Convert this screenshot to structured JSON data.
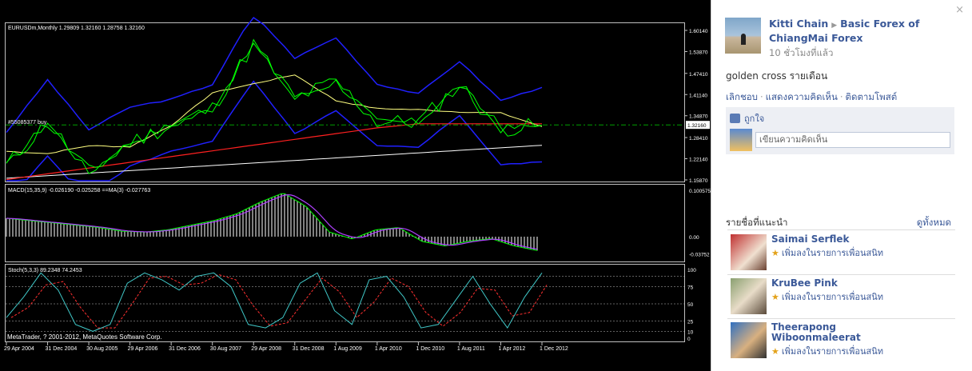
{
  "chart": {
    "symbol_title": "EURUSDm,Monthly  1.29809 1.32160 1.28758 1.32160",
    "hline_label": "#55085377 buy",
    "macd_title": "MACD(15,35,9) -0.026190 -0.025258 ==MA(3) -0.027763",
    "stoch_title": "Stoch(5,3,3) 89.2348 74.2453",
    "copyright": "MetaTrader, ? 2001-2012, MetaQuotes Software Corp.",
    "price_ticks": [
      "1.60140",
      "1.53870",
      "1.47410",
      "1.41140",
      "1.34870",
      "1.28410",
      "1.22140",
      "1.15870"
    ],
    "current_price": "1.32160",
    "macd_ticks": [
      "0.100575",
      "0.00",
      "-0.03752"
    ],
    "stoch_ticks": [
      "100",
      "75",
      "50",
      "25",
      "10",
      "0"
    ],
    "date_labels": [
      "29 Apr 2004",
      "31 Dec 2004",
      "30 Aug 2005",
      "29 Apr 2006",
      "31 Dec 2006",
      "30 Aug 2007",
      "29 Apr 2008",
      "31 Dec 2008",
      "1 Aug 2009",
      "1 Apr 2010",
      "1 Dec 2010",
      "1 Aug 2011",
      "1 Apr 2012",
      "1 Dec 2012"
    ],
    "colors": {
      "price": "#00ff00",
      "yellow_ma": "#ffff80",
      "red_ma": "#ff2020",
      "white_ma": "#ffffff",
      "bands": "#2020ff",
      "hline": "#00a000",
      "macd_signal": "#b040ff",
      "stoch_signal": "#ff3030",
      "stoch_main": "#40c8c8"
    }
  },
  "chart_data": {
    "type": "line",
    "x": [
      "29 Apr 2004",
      "31 Dec 2004",
      "30 Aug 2005",
      "29 Apr 2006",
      "31 Dec 2006",
      "30 Aug 2007",
      "29 Apr 2008",
      "31 Dec 2008",
      "1 Aug 2009",
      "1 Apr 2010",
      "1 Dec 2010",
      "1 Aug 2011",
      "1 Apr 2012",
      "1 Dec 2012"
    ],
    "series": [
      {
        "values": [
          1.2,
          1.33,
          1.18,
          1.27,
          1.32,
          1.37,
          1.56,
          1.4,
          1.45,
          1.33,
          1.33,
          1.44,
          1.31,
          1.32
        ]
      }
    ],
    "ylim": [
      1.1587,
      1.6014
    ],
    "hline": 1.3216
  },
  "sidebar": {
    "close_label": "×",
    "post": {
      "author": "Kitti Chain",
      "group_line1": "Basic Forex of",
      "group_line2": "ChiangMai Forex",
      "time": "10 ชั่วโมงที่แล้ว",
      "text": "golden cross รายเดือน",
      "action_unlike": "เลิกชอบ",
      "action_comments": "แสดงความคิดเห็น",
      "action_follow": "ติดตามโพสต์",
      "like_label": "ถูกใจ",
      "comment_placeholder": "เขียนความคิดเห็น"
    },
    "suggestions": {
      "title": "รายชื่อที่แนะนำ",
      "see_all": "ดูทั้งหมด",
      "add_label": "เพิ่มลงในรายการเพื่อนสนิท",
      "people": [
        {
          "name": "Saimai Serflek"
        },
        {
          "name": "KruBee Pink"
        },
        {
          "name_line1": "Theerapong",
          "name_line2": "Wiboonmaleerat"
        }
      ]
    }
  }
}
